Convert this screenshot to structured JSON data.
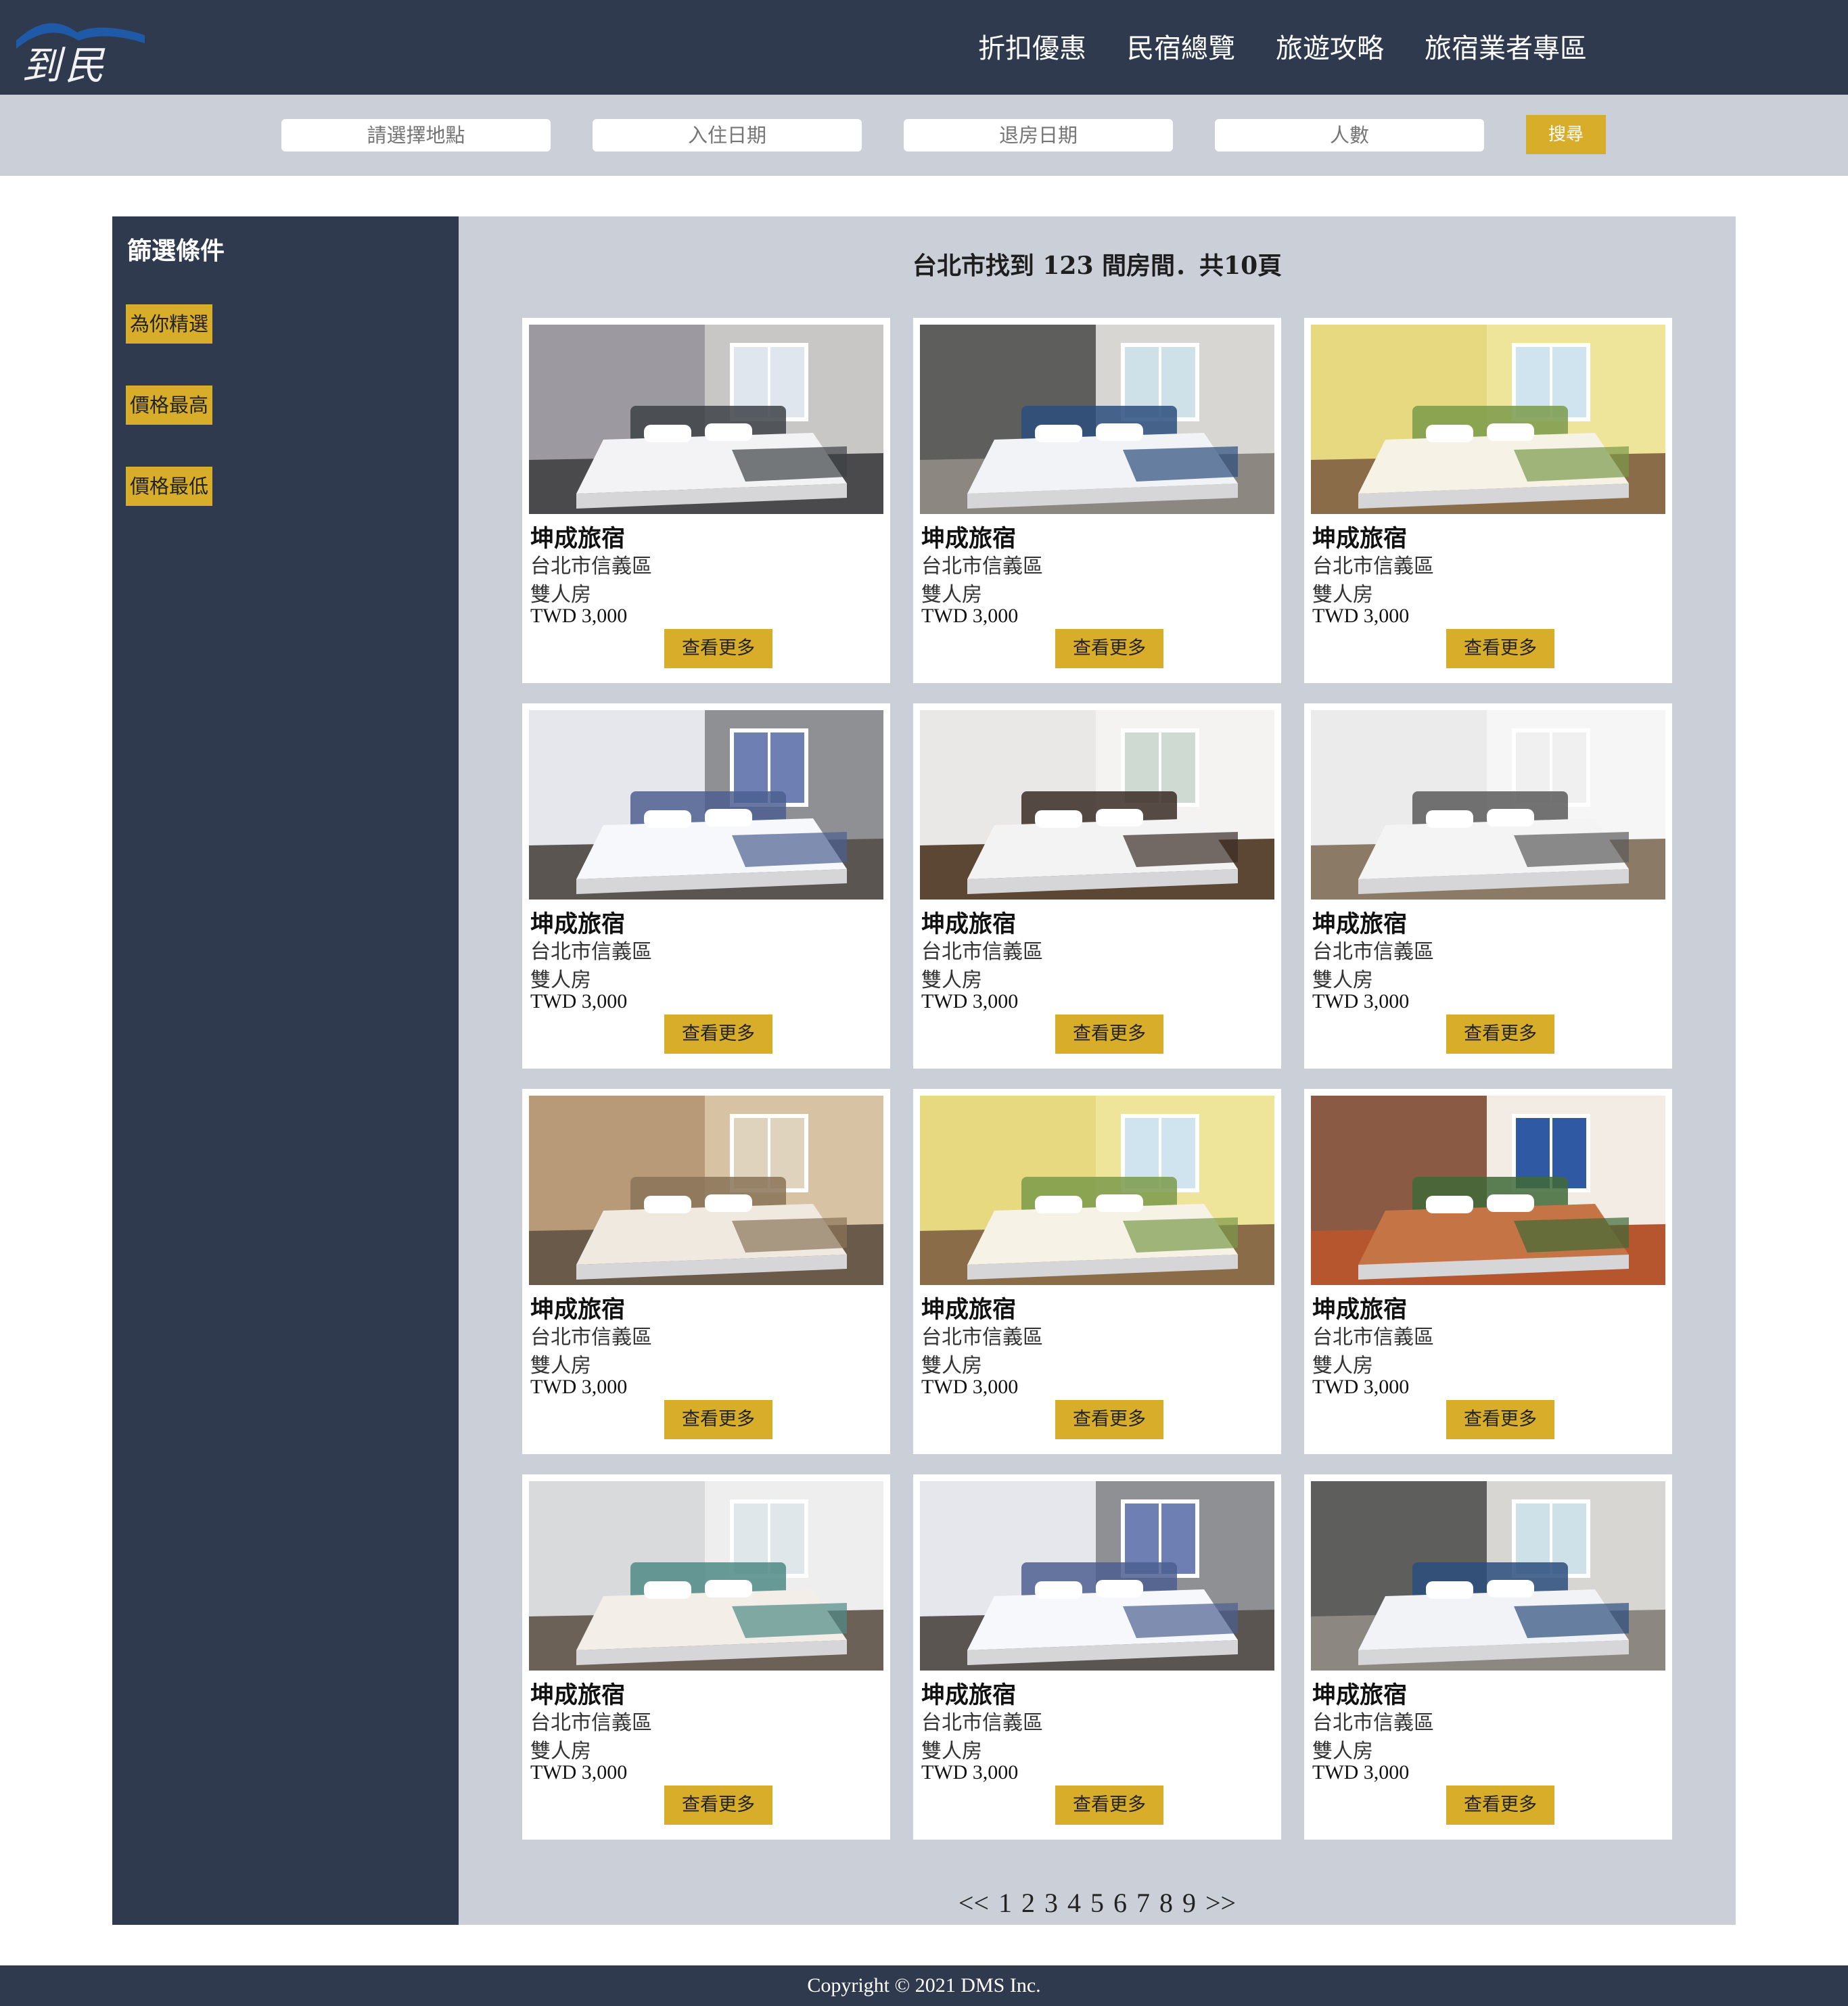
{
  "header": {
    "logo_text": "到民宿",
    "nav": [
      "折扣優惠",
      "民宿總覽",
      "旅遊攻略",
      "旅宿業者專區"
    ]
  },
  "search": {
    "location_placeholder": "請選擇地點",
    "checkin_placeholder": "入住日期",
    "checkout_placeholder": "退房日期",
    "guests_placeholder": "人數",
    "button_label": "搜尋"
  },
  "sidebar": {
    "title": "篩選條件",
    "filters": [
      "為你精選",
      "價格最高",
      "價格最低"
    ]
  },
  "results": {
    "title": "台北市找到 123 間房間．共10頁"
  },
  "cards": [
    {
      "name": "坤成旅宿",
      "location": "台北市信義區",
      "room": "雙人房",
      "price": "TWD 3,000",
      "button": "查看更多",
      "scene": "gray-loft"
    },
    {
      "name": "坤成旅宿",
      "location": "台北市信義區",
      "room": "雙人房",
      "price": "TWD 3,000",
      "button": "查看更多",
      "scene": "dark-wall-sofa"
    },
    {
      "name": "坤成旅宿",
      "location": "台北市信義區",
      "room": "雙人房",
      "price": "TWD 3,000",
      "button": "查看更多",
      "scene": "yellow-kids"
    },
    {
      "name": "坤成旅宿",
      "location": "台北市信義區",
      "room": "雙人房",
      "price": "TWD 3,000",
      "button": "查看更多",
      "scene": "white-blue-curtain"
    },
    {
      "name": "坤成旅宿",
      "location": "台北市信義區",
      "room": "雙人房",
      "price": "TWD 3,000",
      "button": "查看更多",
      "scene": "chandelier"
    },
    {
      "name": "坤成旅宿",
      "location": "台北市信義區",
      "room": "雙人房",
      "price": "TWD 3,000",
      "button": "查看更多",
      "scene": "white-bright"
    },
    {
      "name": "坤成旅宿",
      "location": "台北市信義區",
      "room": "雙人房",
      "price": "TWD 3,000",
      "button": "查看更多",
      "scene": "warm-mirror"
    },
    {
      "name": "坤成旅宿",
      "location": "台北市信義區",
      "room": "雙人房",
      "price": "TWD 3,000",
      "button": "查看更多",
      "scene": "yellow-kids"
    },
    {
      "name": "坤成旅宿",
      "location": "台北市信義區",
      "room": "雙人房",
      "price": "TWD 3,000",
      "button": "查看更多",
      "scene": "brick-lounge"
    },
    {
      "name": "坤成旅宿",
      "location": "台北市信義區",
      "room": "雙人房",
      "price": "TWD 3,000",
      "button": "查看更多",
      "scene": "coral-teal"
    },
    {
      "name": "坤成旅宿",
      "location": "台北市信義區",
      "room": "雙人房",
      "price": "TWD 3,000",
      "button": "查看更多",
      "scene": "white-blue-curtain"
    },
    {
      "name": "坤成旅宿",
      "location": "台北市信義區",
      "room": "雙人房",
      "price": "TWD 3,000",
      "button": "查看更多",
      "scene": "dark-wall-sofa"
    }
  ],
  "pagination": {
    "prev": "<<",
    "pages": [
      "1",
      "2",
      "3",
      "4",
      "5",
      "6",
      "7",
      "8",
      "9"
    ],
    "next": ">>"
  },
  "footer": {
    "copyright": "Copyright © 2021 DMS Inc."
  },
  "colors": {
    "navy": "#2f3a4f",
    "gray": "#cbcfd7",
    "gold": "#d7ad2a"
  }
}
